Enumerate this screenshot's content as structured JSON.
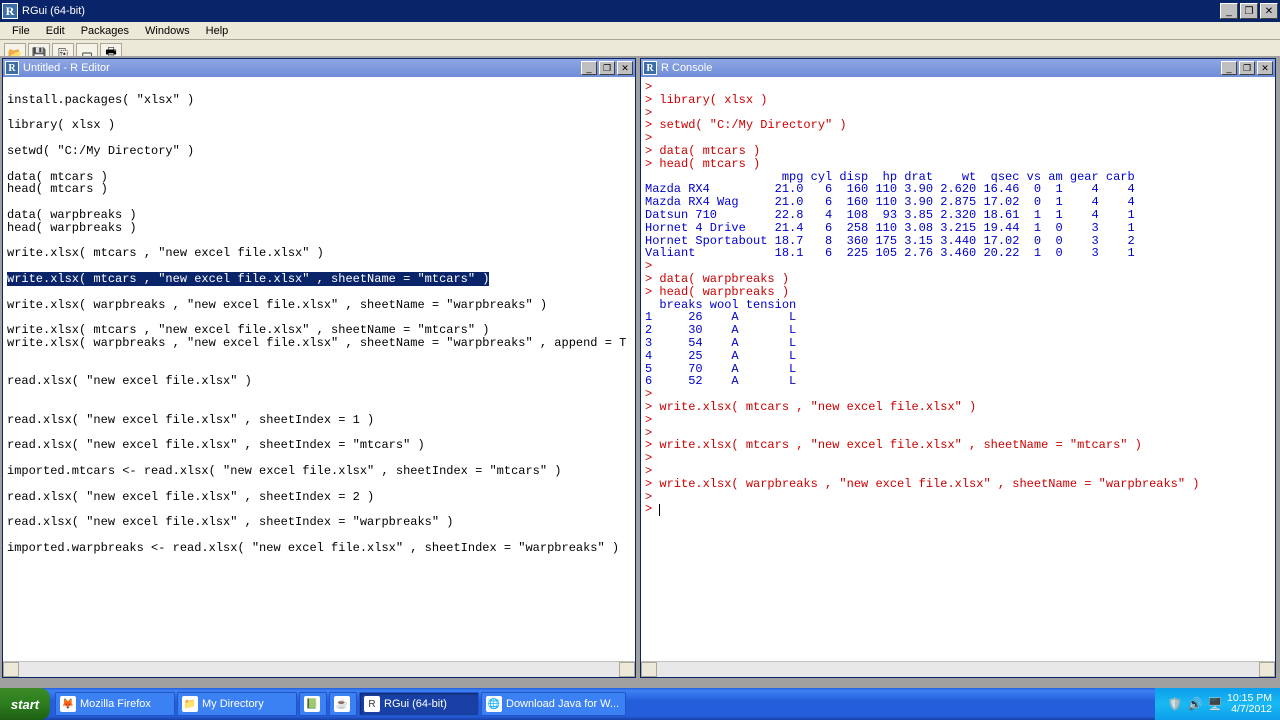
{
  "app": {
    "title": "RGui (64-bit)",
    "menus": [
      "File",
      "Edit",
      "Packages",
      "Windows",
      "Help"
    ]
  },
  "editor": {
    "title": "Untitled - R Editor",
    "lines": [
      "",
      "install.packages( \"xlsx\" )",
      "",
      "library( xlsx )",
      "",
      "setwd( \"C:/My Directory\" )",
      "",
      "data( mtcars )",
      "head( mtcars )",
      "",
      "data( warpbreaks )",
      "head( warpbreaks )",
      "",
      "write.xlsx( mtcars , \"new excel file.xlsx\" )",
      "",
      "write.xlsx( mtcars , \"new excel file.xlsx\" , sheetName = \"mtcars\" )",
      "",
      "write.xlsx( warpbreaks , \"new excel file.xlsx\" , sheetName = \"warpbreaks\" )",
      "",
      "write.xlsx( mtcars , \"new excel file.xlsx\" , sheetName = \"mtcars\" )",
      "write.xlsx( warpbreaks , \"new excel file.xlsx\" , sheetName = \"warpbreaks\" , append = T )",
      "",
      "",
      "read.xlsx( \"new excel file.xlsx\" )",
      "",
      "",
      "read.xlsx( \"new excel file.xlsx\" , sheetIndex = 1 )",
      "",
      "read.xlsx( \"new excel file.xlsx\" , sheetIndex = \"mtcars\" )",
      "",
      "imported.mtcars <- read.xlsx( \"new excel file.xlsx\" , sheetIndex = \"mtcars\" )",
      "",
      "read.xlsx( \"new excel file.xlsx\" , sheetIndex = 2 )",
      "",
      "read.xlsx( \"new excel file.xlsx\" , sheetIndex = \"warpbreaks\" )",
      "",
      "imported.warpbreaks <- read.xlsx( \"new excel file.xlsx\" , sheetIndex = \"warpbreaks\" )"
    ],
    "selected_line_index": 15
  },
  "console": {
    "title": "R Console",
    "lines": [
      {
        "t": "prompt",
        "v": "> "
      },
      {
        "t": "cmd",
        "v": "> library( xlsx )"
      },
      {
        "t": "prompt",
        "v": "> "
      },
      {
        "t": "cmd",
        "v": "> setwd( \"C:/My Directory\" )"
      },
      {
        "t": "prompt",
        "v": "> "
      },
      {
        "t": "cmd",
        "v": "> data( mtcars )"
      },
      {
        "t": "cmd",
        "v": "> head( mtcars )"
      },
      {
        "t": "out",
        "v": "                   mpg cyl disp  hp drat    wt  qsec vs am gear carb"
      },
      {
        "t": "out",
        "v": "Mazda RX4         21.0   6  160 110 3.90 2.620 16.46  0  1    4    4"
      },
      {
        "t": "out",
        "v": "Mazda RX4 Wag     21.0   6  160 110 3.90 2.875 17.02  0  1    4    4"
      },
      {
        "t": "out",
        "v": "Datsun 710        22.8   4  108  93 3.85 2.320 18.61  1  1    4    1"
      },
      {
        "t": "out",
        "v": "Hornet 4 Drive    21.4   6  258 110 3.08 3.215 19.44  1  0    3    1"
      },
      {
        "t": "out",
        "v": "Hornet Sportabout 18.7   8  360 175 3.15 3.440 17.02  0  0    3    2"
      },
      {
        "t": "out",
        "v": "Valiant           18.1   6  225 105 2.76 3.460 20.22  1  0    3    1"
      },
      {
        "t": "prompt",
        "v": "> "
      },
      {
        "t": "cmd",
        "v": "> data( warpbreaks )"
      },
      {
        "t": "cmd",
        "v": "> head( warpbreaks )"
      },
      {
        "t": "out",
        "v": "  breaks wool tension"
      },
      {
        "t": "out",
        "v": "1     26    A       L"
      },
      {
        "t": "out",
        "v": "2     30    A       L"
      },
      {
        "t": "out",
        "v": "3     54    A       L"
      },
      {
        "t": "out",
        "v": "4     25    A       L"
      },
      {
        "t": "out",
        "v": "5     70    A       L"
      },
      {
        "t": "out",
        "v": "6     52    A       L"
      },
      {
        "t": "prompt",
        "v": "> "
      },
      {
        "t": "cmd",
        "v": "> write.xlsx( mtcars , \"new excel file.xlsx\" )"
      },
      {
        "t": "prompt",
        "v": "> "
      },
      {
        "t": "prompt",
        "v": "> "
      },
      {
        "t": "cmd",
        "v": "> write.xlsx( mtcars , \"new excel file.xlsx\" , sheetName = \"mtcars\" )"
      },
      {
        "t": "prompt",
        "v": "> "
      },
      {
        "t": "prompt",
        "v": "> "
      },
      {
        "t": "cmd",
        "v": "> write.xlsx( warpbreaks , \"new excel file.xlsx\" , sheetName = \"warpbreaks\" )"
      },
      {
        "t": "prompt",
        "v": "> "
      },
      {
        "t": "input",
        "v": "> "
      }
    ]
  },
  "taskbar": {
    "start": "start",
    "buttons": [
      {
        "label": "Mozilla Firefox",
        "icon": "🦊",
        "active": false
      },
      {
        "label": "My Directory",
        "icon": "📁",
        "active": false
      },
      {
        "label": "",
        "icon": "📗",
        "active": false,
        "narrow": true
      },
      {
        "label": "",
        "icon": "☕",
        "active": false,
        "narrow": true
      },
      {
        "label": "RGui (64-bit)",
        "icon": "R",
        "active": true
      },
      {
        "label": "Download Java for W...",
        "icon": "🌐",
        "active": false
      }
    ],
    "clock_time": "10:15 PM",
    "clock_date": "4/7/2012"
  }
}
